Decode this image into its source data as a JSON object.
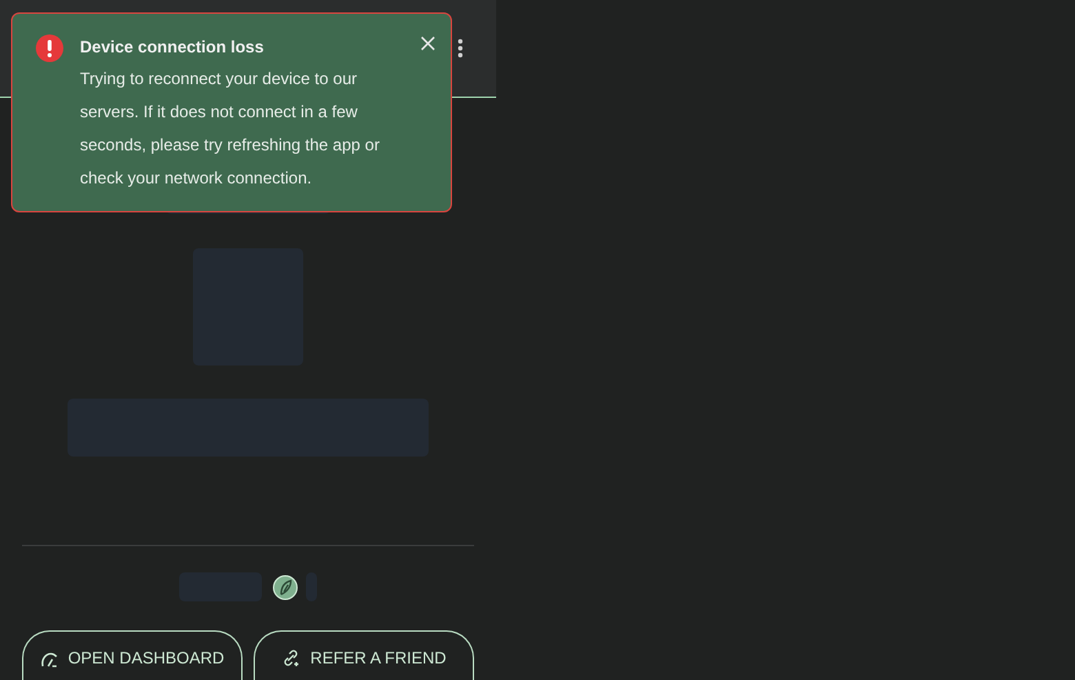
{
  "toast": {
    "title": "Device connection loss",
    "message": "Trying to reconnect your device to our servers. If it does not connect in a few seconds, please try refreshing the app or check your network connection."
  },
  "buttons": [
    {
      "label": "OPEN DASHBOARD",
      "kind": "dashboard"
    },
    {
      "label": "REFER A FRIEND",
      "kind": "referral"
    }
  ]
}
